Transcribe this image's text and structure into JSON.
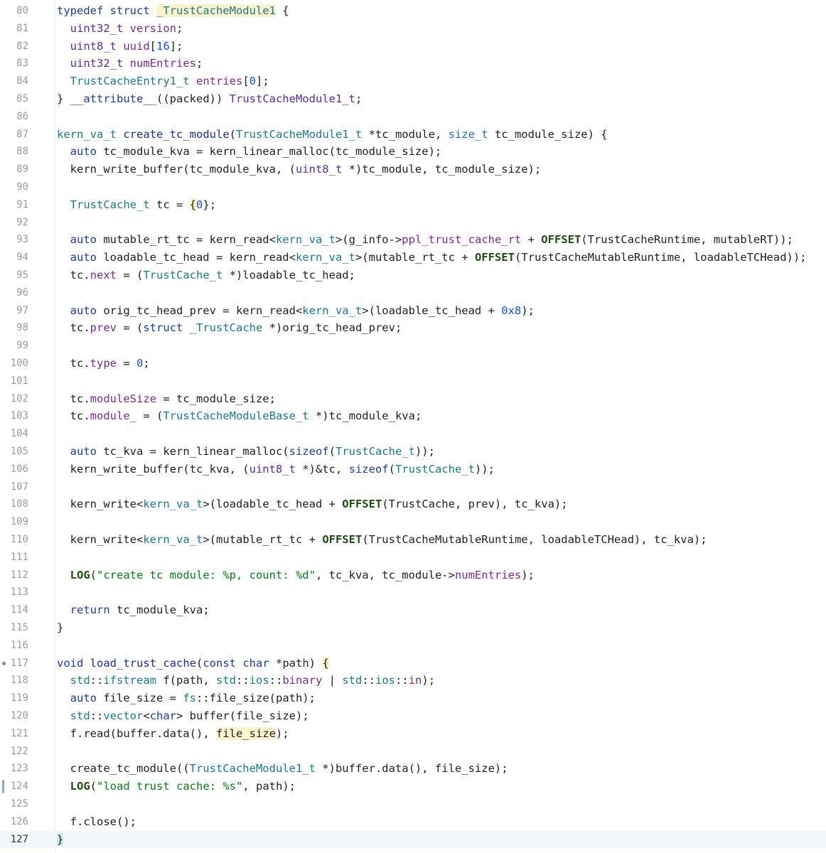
{
  "editor": {
    "current_line": 127,
    "lines": [
      {
        "n": "80",
        "segs": [
          [
            "typedef struct ",
            "kw"
          ],
          [
            "_TrustCacheModule1",
            "ty hl"
          ],
          [
            " {",
            ""
          ]
        ]
      },
      {
        "n": "81",
        "segs": [
          [
            "  ",
            ""
          ],
          [
            "uint32_t",
            "uty"
          ],
          [
            " ",
            ""
          ],
          [
            "version",
            "fld"
          ],
          [
            ";",
            ""
          ]
        ]
      },
      {
        "n": "82",
        "segs": [
          [
            "  ",
            ""
          ],
          [
            "uint8_t",
            "uty"
          ],
          [
            " ",
            ""
          ],
          [
            "uuid",
            "fld"
          ],
          [
            "[",
            ""
          ],
          [
            "16",
            "num"
          ],
          [
            "];",
            ""
          ]
        ]
      },
      {
        "n": "83",
        "segs": [
          [
            "  ",
            ""
          ],
          [
            "uint32_t",
            "uty"
          ],
          [
            " ",
            ""
          ],
          [
            "numEntries",
            "fld"
          ],
          [
            ";",
            ""
          ]
        ]
      },
      {
        "n": "84",
        "segs": [
          [
            "  ",
            ""
          ],
          [
            "TrustCacheEntry1_t",
            "ty"
          ],
          [
            " ",
            ""
          ],
          [
            "entries",
            "fld"
          ],
          [
            "[",
            ""
          ],
          [
            "0",
            "num"
          ],
          [
            "];",
            ""
          ]
        ]
      },
      {
        "n": "85",
        "segs": [
          [
            "} ",
            ""
          ],
          [
            "__attribute__",
            "kw"
          ],
          [
            "((packed)) ",
            ""
          ],
          [
            "TrustCacheModule1_t",
            "uty"
          ],
          [
            ";",
            ""
          ]
        ]
      },
      {
        "n": "86",
        "segs": []
      },
      {
        "n": "87",
        "segs": [
          [
            "kern_va_t",
            "ty"
          ],
          [
            " ",
            ""
          ],
          [
            "create_tc_module",
            "fn"
          ],
          [
            "(",
            ""
          ],
          [
            "TrustCacheModule1_t",
            "ty"
          ],
          [
            " *tc_module, ",
            ""
          ],
          [
            "size_t",
            "ty"
          ],
          [
            " tc_module_size) {",
            ""
          ]
        ]
      },
      {
        "n": "88",
        "segs": [
          [
            "  ",
            ""
          ],
          [
            "auto",
            "kw"
          ],
          [
            " tc_module_kva = kern_linear_malloc(tc_module_size);",
            ""
          ]
        ]
      },
      {
        "n": "89",
        "segs": [
          [
            "  kern_write_buffer(tc_module_kva, (",
            ""
          ],
          [
            "uint8_t",
            "uty"
          ],
          [
            " *)tc_module, tc_module_size);",
            ""
          ]
        ]
      },
      {
        "n": "90",
        "segs": []
      },
      {
        "n": "91",
        "segs": [
          [
            "  ",
            ""
          ],
          [
            "TrustCache_t",
            "ty"
          ],
          [
            " tc = ",
            ""
          ],
          [
            "{",
            "hl"
          ],
          [
            "0",
            "num"
          ],
          [
            "}",
            ""
          ],
          [
            ";",
            ""
          ]
        ]
      },
      {
        "n": "92",
        "segs": []
      },
      {
        "n": "93",
        "segs": [
          [
            "  ",
            ""
          ],
          [
            "auto",
            "kw"
          ],
          [
            " mutable_rt_tc = kern_read<",
            ""
          ],
          [
            "kern_va_t",
            "ty"
          ],
          [
            ">(g_info->",
            ""
          ],
          [
            "ppl_trust_cache_rt",
            "fld"
          ],
          [
            " + ",
            ""
          ],
          [
            "OFFSET",
            "mac"
          ],
          [
            "(TrustCacheRuntime, mutableRT));",
            ""
          ]
        ]
      },
      {
        "n": "94",
        "segs": [
          [
            "  ",
            ""
          ],
          [
            "auto",
            "kw"
          ],
          [
            " loadable_tc_head = kern_read<",
            ""
          ],
          [
            "kern_va_t",
            "ty"
          ],
          [
            ">(mutable_rt_tc + ",
            ""
          ],
          [
            "OFFSET",
            "mac"
          ],
          [
            "(TrustCacheMutableRuntime, loadableTCHead));",
            ""
          ]
        ]
      },
      {
        "n": "95",
        "segs": [
          [
            "  tc.",
            ""
          ],
          [
            "next",
            "fld"
          ],
          [
            " = (",
            ""
          ],
          [
            "TrustCache_t",
            "ty"
          ],
          [
            " *)loadable_tc_head;",
            ""
          ]
        ]
      },
      {
        "n": "96",
        "segs": []
      },
      {
        "n": "97",
        "segs": [
          [
            "  ",
            ""
          ],
          [
            "auto",
            "kw"
          ],
          [
            " orig_tc_head_prev = kern_read<",
            ""
          ],
          [
            "kern_va_t",
            "ty"
          ],
          [
            ">(loadable_tc_head + ",
            ""
          ],
          [
            "0x8",
            "num"
          ],
          [
            ");",
            ""
          ]
        ]
      },
      {
        "n": "98",
        "segs": [
          [
            "  tc.",
            ""
          ],
          [
            "prev",
            "fld"
          ],
          [
            " = (",
            ""
          ],
          [
            "struct",
            "kw"
          ],
          [
            " ",
            ""
          ],
          [
            "_TrustCache",
            "ty"
          ],
          [
            " *)orig_tc_head_prev;",
            ""
          ]
        ]
      },
      {
        "n": "99",
        "segs": []
      },
      {
        "n": "100",
        "segs": [
          [
            "  tc.",
            ""
          ],
          [
            "type",
            "fld"
          ],
          [
            " = ",
            ""
          ],
          [
            "0",
            "num"
          ],
          [
            ";",
            ""
          ]
        ]
      },
      {
        "n": "101",
        "segs": []
      },
      {
        "n": "102",
        "segs": [
          [
            "  tc.",
            ""
          ],
          [
            "moduleSize",
            "fld"
          ],
          [
            " = tc_module_size;",
            ""
          ]
        ]
      },
      {
        "n": "103",
        "segs": [
          [
            "  tc.",
            ""
          ],
          [
            "module_",
            "fld"
          ],
          [
            " = (",
            ""
          ],
          [
            "TrustCacheModuleBase_t",
            "ty"
          ],
          [
            " *)tc_module_kva;",
            ""
          ]
        ]
      },
      {
        "n": "104",
        "segs": []
      },
      {
        "n": "105",
        "segs": [
          [
            "  ",
            ""
          ],
          [
            "auto",
            "kw"
          ],
          [
            " tc_kva = kern_linear_malloc(",
            ""
          ],
          [
            "sizeof",
            "kw"
          ],
          [
            "(",
            ""
          ],
          [
            "TrustCache_t",
            "ty"
          ],
          [
            "));",
            ""
          ]
        ]
      },
      {
        "n": "106",
        "segs": [
          [
            "  kern_write_buffer(tc_kva, (",
            ""
          ],
          [
            "uint8_t",
            "uty"
          ],
          [
            " *)&tc, ",
            ""
          ],
          [
            "sizeof",
            "kw"
          ],
          [
            "(",
            ""
          ],
          [
            "TrustCache_t",
            "ty"
          ],
          [
            "));",
            ""
          ]
        ]
      },
      {
        "n": "107",
        "segs": []
      },
      {
        "n": "108",
        "segs": [
          [
            "  kern_write<",
            ""
          ],
          [
            "kern_va_t",
            "ty"
          ],
          [
            ">(loadable_tc_head + ",
            ""
          ],
          [
            "OFFSET",
            "mac"
          ],
          [
            "(TrustCache, prev), tc_kva);",
            ""
          ]
        ]
      },
      {
        "n": "109",
        "segs": []
      },
      {
        "n": "110",
        "segs": [
          [
            "  kern_write<",
            ""
          ],
          [
            "kern_va_t",
            "ty"
          ],
          [
            ">(mutable_rt_tc + ",
            ""
          ],
          [
            "OFFSET",
            "mac"
          ],
          [
            "(TrustCacheMutableRuntime, loadableTCHead), tc_kva);",
            ""
          ]
        ]
      },
      {
        "n": "111",
        "segs": []
      },
      {
        "n": "112",
        "segs": [
          [
            "  ",
            ""
          ],
          [
            "LOG",
            "mac"
          ],
          [
            "(",
            ""
          ],
          [
            "\"create tc module: %p, count: %d\"",
            "str"
          ],
          [
            ", tc_kva, tc_module->",
            ""
          ],
          [
            "numEntries",
            "fld"
          ],
          [
            ");",
            ""
          ]
        ]
      },
      {
        "n": "113",
        "segs": []
      },
      {
        "n": "114",
        "segs": [
          [
            "  ",
            ""
          ],
          [
            "return",
            "kw"
          ],
          [
            " tc_module_kva;",
            ""
          ]
        ]
      },
      {
        "n": "115",
        "segs": [
          [
            "}",
            ""
          ]
        ]
      },
      {
        "n": "116",
        "segs": []
      },
      {
        "n": "117",
        "segs": [
          [
            "void",
            "kw"
          ],
          [
            " ",
            ""
          ],
          [
            "load_trust_cache",
            "fn"
          ],
          [
            "(",
            ""
          ],
          [
            "const char",
            "kw"
          ],
          [
            " *path) ",
            ""
          ],
          [
            "{",
            "hl"
          ]
        ]
      },
      {
        "n": "118",
        "segs": [
          [
            "  ",
            ""
          ],
          [
            "std",
            "ty"
          ],
          [
            "::",
            ""
          ],
          [
            "ifstream",
            "ty"
          ],
          [
            " f(path, ",
            ""
          ],
          [
            "std",
            "ty"
          ],
          [
            "::",
            ""
          ],
          [
            "ios",
            "ty"
          ],
          [
            "::",
            ""
          ],
          [
            "binary",
            "fld"
          ],
          [
            " | ",
            ""
          ],
          [
            "std",
            "ty"
          ],
          [
            "::",
            ""
          ],
          [
            "ios",
            "ty"
          ],
          [
            "::",
            ""
          ],
          [
            "in",
            "fld"
          ],
          [
            ");",
            ""
          ]
        ]
      },
      {
        "n": "119",
        "segs": [
          [
            "  ",
            ""
          ],
          [
            "auto",
            "kw"
          ],
          [
            " file_size = ",
            ""
          ],
          [
            "fs",
            "ty"
          ],
          [
            "::file_size(path);",
            ""
          ]
        ]
      },
      {
        "n": "120",
        "segs": [
          [
            "  ",
            ""
          ],
          [
            "std",
            "ty"
          ],
          [
            "::",
            ""
          ],
          [
            "vector",
            "ty"
          ],
          [
            "<",
            ""
          ],
          [
            "char",
            "kw"
          ],
          [
            "> buffer(file_size);",
            ""
          ]
        ]
      },
      {
        "n": "121",
        "segs": [
          [
            "  f.read(buffer.data(), ",
            ""
          ],
          [
            "file_size",
            "hl"
          ],
          [
            ");",
            ""
          ]
        ]
      },
      {
        "n": "122",
        "segs": []
      },
      {
        "n": "123",
        "segs": [
          [
            "  create_tc_module((",
            ""
          ],
          [
            "TrustCacheModule1_t",
            "ty"
          ],
          [
            " *)buffer.data(), file_size);",
            ""
          ]
        ]
      },
      {
        "n": "124",
        "segs": [
          [
            "  ",
            ""
          ],
          [
            "LOG",
            "mac"
          ],
          [
            "(",
            ""
          ],
          [
            "\"load trust cache: %s\"",
            "str"
          ],
          [
            ", path);",
            ""
          ]
        ]
      },
      {
        "n": "125",
        "segs": []
      },
      {
        "n": "126",
        "segs": [
          [
            "  f.close();",
            ""
          ]
        ]
      },
      {
        "n": "127",
        "segs": [
          [
            "}",
            "brk"
          ]
        ]
      }
    ]
  }
}
